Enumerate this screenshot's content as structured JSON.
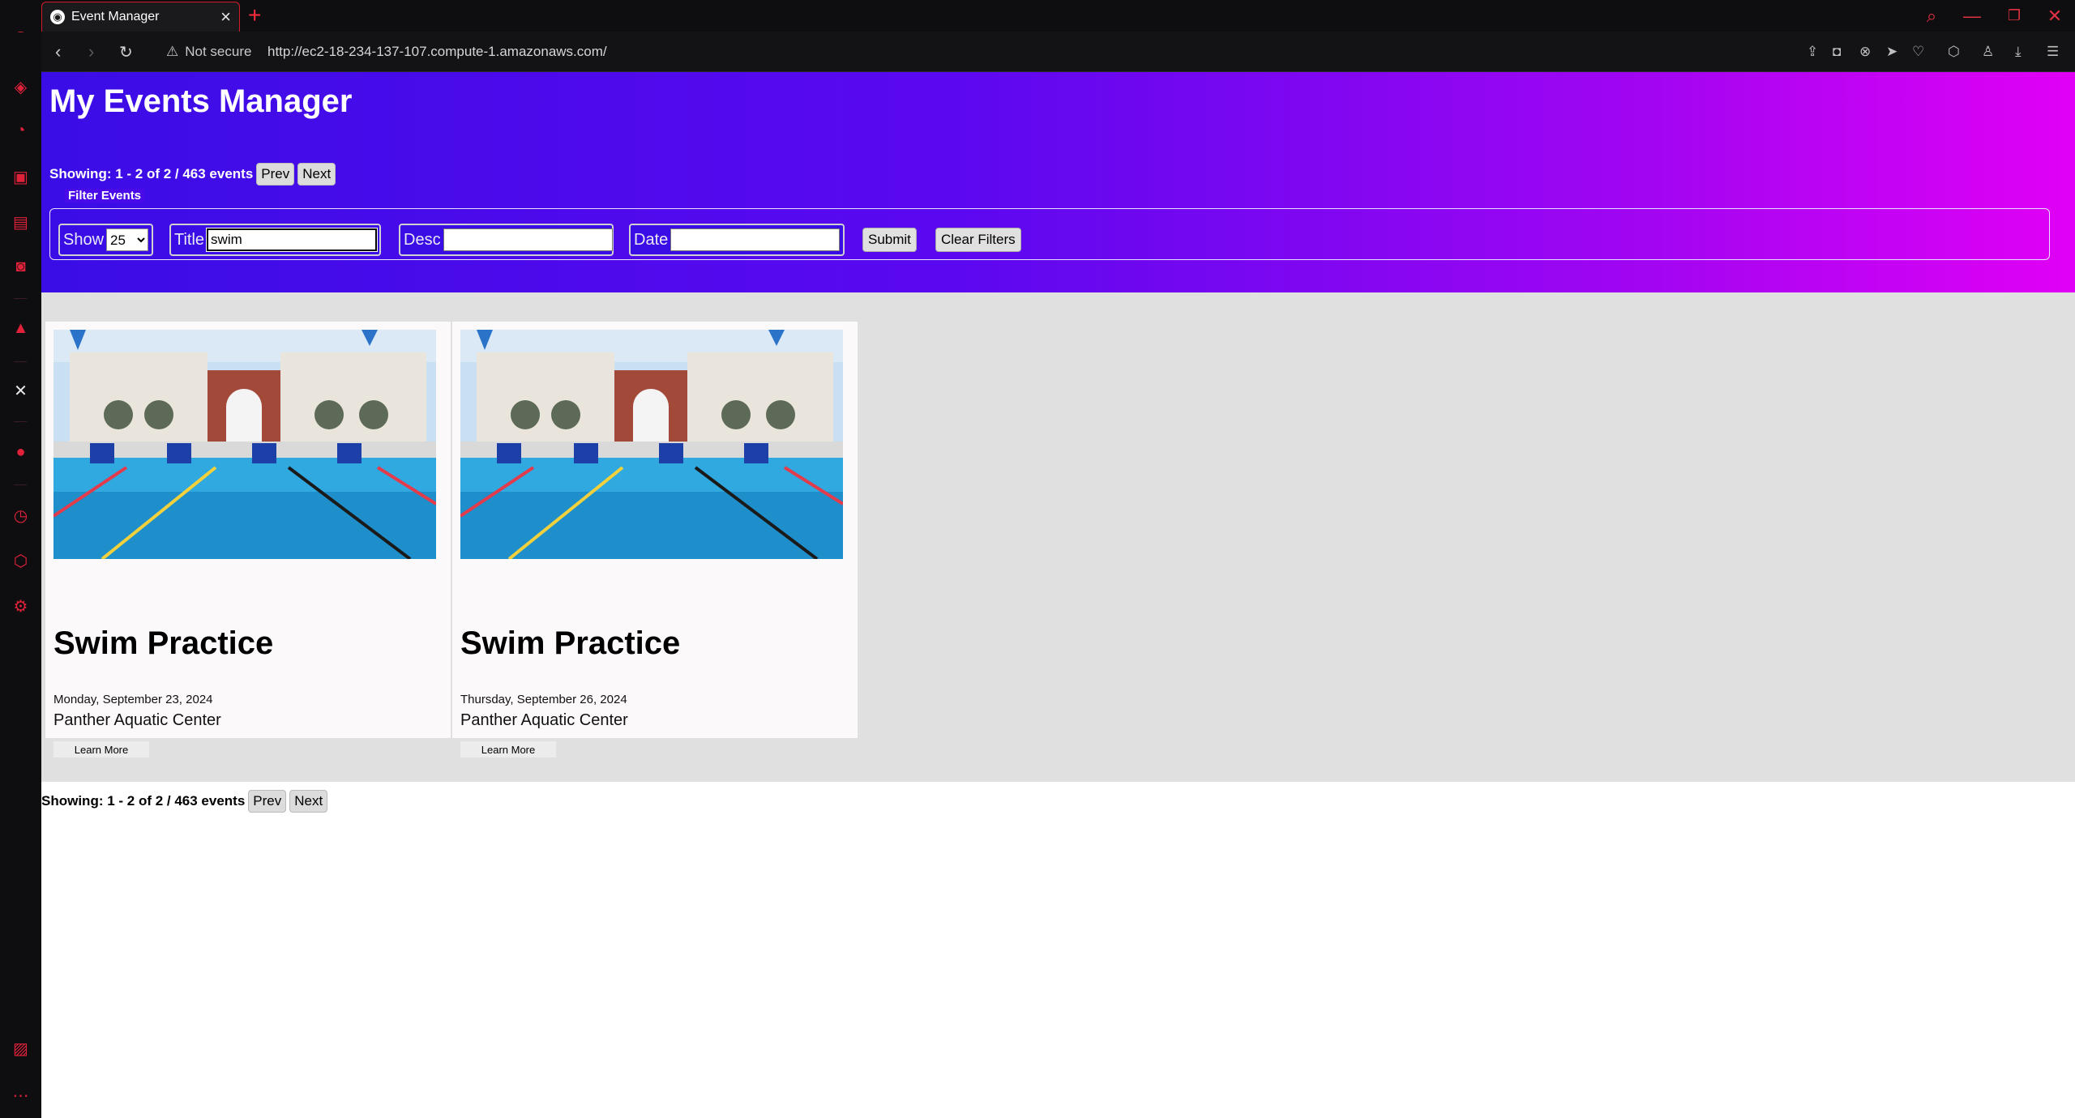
{
  "browser": {
    "tab_title": "Event Manager",
    "security_label": "Not secure",
    "url": "http://ec2-18-234-137-107.compute-1.amazonaws.com/"
  },
  "page": {
    "title": "My Events Manager",
    "paging": {
      "showing_text": "Showing: 1 - 2 of 2 / 463 events",
      "prev_label": "Prev",
      "next_label": "Next"
    },
    "filters": {
      "legend": "Filter Events",
      "show_label": "Show",
      "show_value": "25",
      "title_label": "Title",
      "title_value": "swim",
      "desc_label": "Desc",
      "desc_value": "",
      "date_label": "Date",
      "date_value": "",
      "submit_label": "Submit",
      "clear_label": "Clear Filters"
    },
    "events": [
      {
        "title": "Swim Practice",
        "date": "Monday, September 23, 2024",
        "location": "Panther Aquatic Center",
        "button": "Learn More"
      },
      {
        "title": "Swim Practice",
        "date": "Thursday, September 26, 2024",
        "location": "Panther Aquatic Center",
        "button": "Learn More"
      }
    ]
  },
  "colors": {
    "hero_start": "#3a0de6",
    "hero_end": "#e100f5",
    "browser_accent": "#e0213a"
  }
}
